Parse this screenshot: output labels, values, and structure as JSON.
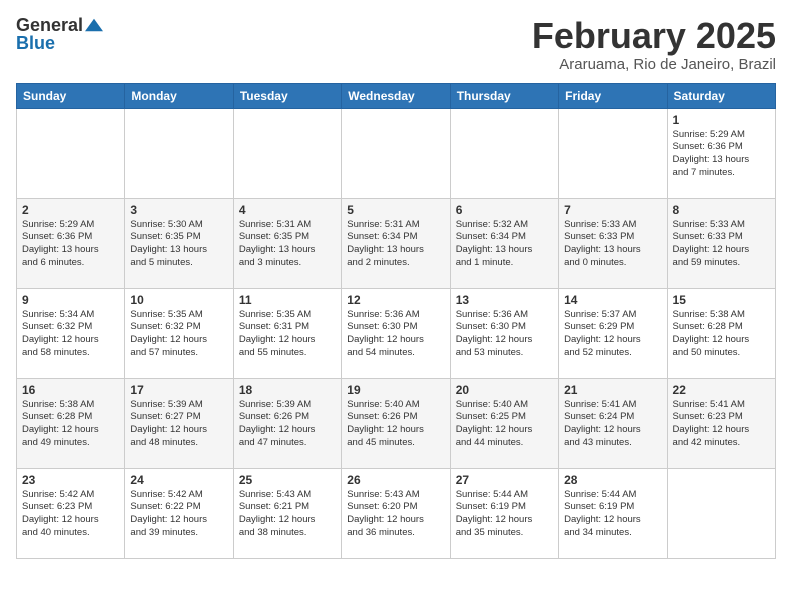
{
  "header": {
    "logo_general": "General",
    "logo_blue": "Blue",
    "month_title": "February 2025",
    "location": "Araruama, Rio de Janeiro, Brazil"
  },
  "days_of_week": [
    "Sunday",
    "Monday",
    "Tuesday",
    "Wednesday",
    "Thursday",
    "Friday",
    "Saturday"
  ],
  "weeks": [
    [
      {
        "day": "",
        "info": ""
      },
      {
        "day": "",
        "info": ""
      },
      {
        "day": "",
        "info": ""
      },
      {
        "day": "",
        "info": ""
      },
      {
        "day": "",
        "info": ""
      },
      {
        "day": "",
        "info": ""
      },
      {
        "day": "1",
        "info": "Sunrise: 5:29 AM\nSunset: 6:36 PM\nDaylight: 13 hours\nand 7 minutes."
      }
    ],
    [
      {
        "day": "2",
        "info": "Sunrise: 5:29 AM\nSunset: 6:36 PM\nDaylight: 13 hours\nand 6 minutes."
      },
      {
        "day": "3",
        "info": "Sunrise: 5:30 AM\nSunset: 6:35 PM\nDaylight: 13 hours\nand 5 minutes."
      },
      {
        "day": "4",
        "info": "Sunrise: 5:31 AM\nSunset: 6:35 PM\nDaylight: 13 hours\nand 3 minutes."
      },
      {
        "day": "5",
        "info": "Sunrise: 5:31 AM\nSunset: 6:34 PM\nDaylight: 13 hours\nand 2 minutes."
      },
      {
        "day": "6",
        "info": "Sunrise: 5:32 AM\nSunset: 6:34 PM\nDaylight: 13 hours\nand 1 minute."
      },
      {
        "day": "7",
        "info": "Sunrise: 5:33 AM\nSunset: 6:33 PM\nDaylight: 13 hours\nand 0 minutes."
      },
      {
        "day": "8",
        "info": "Sunrise: 5:33 AM\nSunset: 6:33 PM\nDaylight: 12 hours\nand 59 minutes."
      }
    ],
    [
      {
        "day": "9",
        "info": "Sunrise: 5:34 AM\nSunset: 6:32 PM\nDaylight: 12 hours\nand 58 minutes."
      },
      {
        "day": "10",
        "info": "Sunrise: 5:35 AM\nSunset: 6:32 PM\nDaylight: 12 hours\nand 57 minutes."
      },
      {
        "day": "11",
        "info": "Sunrise: 5:35 AM\nSunset: 6:31 PM\nDaylight: 12 hours\nand 55 minutes."
      },
      {
        "day": "12",
        "info": "Sunrise: 5:36 AM\nSunset: 6:30 PM\nDaylight: 12 hours\nand 54 minutes."
      },
      {
        "day": "13",
        "info": "Sunrise: 5:36 AM\nSunset: 6:30 PM\nDaylight: 12 hours\nand 53 minutes."
      },
      {
        "day": "14",
        "info": "Sunrise: 5:37 AM\nSunset: 6:29 PM\nDaylight: 12 hours\nand 52 minutes."
      },
      {
        "day": "15",
        "info": "Sunrise: 5:38 AM\nSunset: 6:28 PM\nDaylight: 12 hours\nand 50 minutes."
      }
    ],
    [
      {
        "day": "16",
        "info": "Sunrise: 5:38 AM\nSunset: 6:28 PM\nDaylight: 12 hours\nand 49 minutes."
      },
      {
        "day": "17",
        "info": "Sunrise: 5:39 AM\nSunset: 6:27 PM\nDaylight: 12 hours\nand 48 minutes."
      },
      {
        "day": "18",
        "info": "Sunrise: 5:39 AM\nSunset: 6:26 PM\nDaylight: 12 hours\nand 47 minutes."
      },
      {
        "day": "19",
        "info": "Sunrise: 5:40 AM\nSunset: 6:26 PM\nDaylight: 12 hours\nand 45 minutes."
      },
      {
        "day": "20",
        "info": "Sunrise: 5:40 AM\nSunset: 6:25 PM\nDaylight: 12 hours\nand 44 minutes."
      },
      {
        "day": "21",
        "info": "Sunrise: 5:41 AM\nSunset: 6:24 PM\nDaylight: 12 hours\nand 43 minutes."
      },
      {
        "day": "22",
        "info": "Sunrise: 5:41 AM\nSunset: 6:23 PM\nDaylight: 12 hours\nand 42 minutes."
      }
    ],
    [
      {
        "day": "23",
        "info": "Sunrise: 5:42 AM\nSunset: 6:23 PM\nDaylight: 12 hours\nand 40 minutes."
      },
      {
        "day": "24",
        "info": "Sunrise: 5:42 AM\nSunset: 6:22 PM\nDaylight: 12 hours\nand 39 minutes."
      },
      {
        "day": "25",
        "info": "Sunrise: 5:43 AM\nSunset: 6:21 PM\nDaylight: 12 hours\nand 38 minutes."
      },
      {
        "day": "26",
        "info": "Sunrise: 5:43 AM\nSunset: 6:20 PM\nDaylight: 12 hours\nand 36 minutes."
      },
      {
        "day": "27",
        "info": "Sunrise: 5:44 AM\nSunset: 6:19 PM\nDaylight: 12 hours\nand 35 minutes."
      },
      {
        "day": "28",
        "info": "Sunrise: 5:44 AM\nSunset: 6:19 PM\nDaylight: 12 hours\nand 34 minutes."
      },
      {
        "day": "",
        "info": ""
      }
    ]
  ]
}
